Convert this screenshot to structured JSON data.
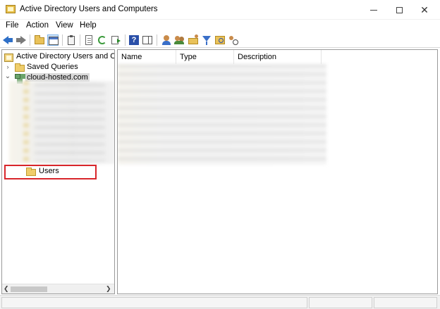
{
  "window": {
    "title": "Active Directory Users and Computers"
  },
  "menu": {
    "file": "File",
    "action": "Action",
    "view": "View",
    "help": "Help"
  },
  "toolbar": {
    "icons": [
      "back-arrow-icon",
      "forward-arrow-icon",
      "up-folder-icon",
      "show-console-tree-icon",
      "clipboard-icon",
      "properties-icon",
      "refresh-icon",
      "export-list-icon",
      "help-icon",
      "action-pane-icon",
      "new-user-icon",
      "new-group-icon",
      "new-ou-icon",
      "filter-icon",
      "query-icon",
      "find-icon"
    ]
  },
  "tree": {
    "root_label": "Active Directory Users and Com",
    "saved_queries_label": "Saved Queries",
    "domain_label": "cloud-hosted.com",
    "users_label": "Users"
  },
  "list": {
    "columns": [
      "Name",
      "Type",
      "Description"
    ]
  },
  "colors": {
    "highlight": "#d8262b",
    "selection": "#d9d9d9"
  }
}
